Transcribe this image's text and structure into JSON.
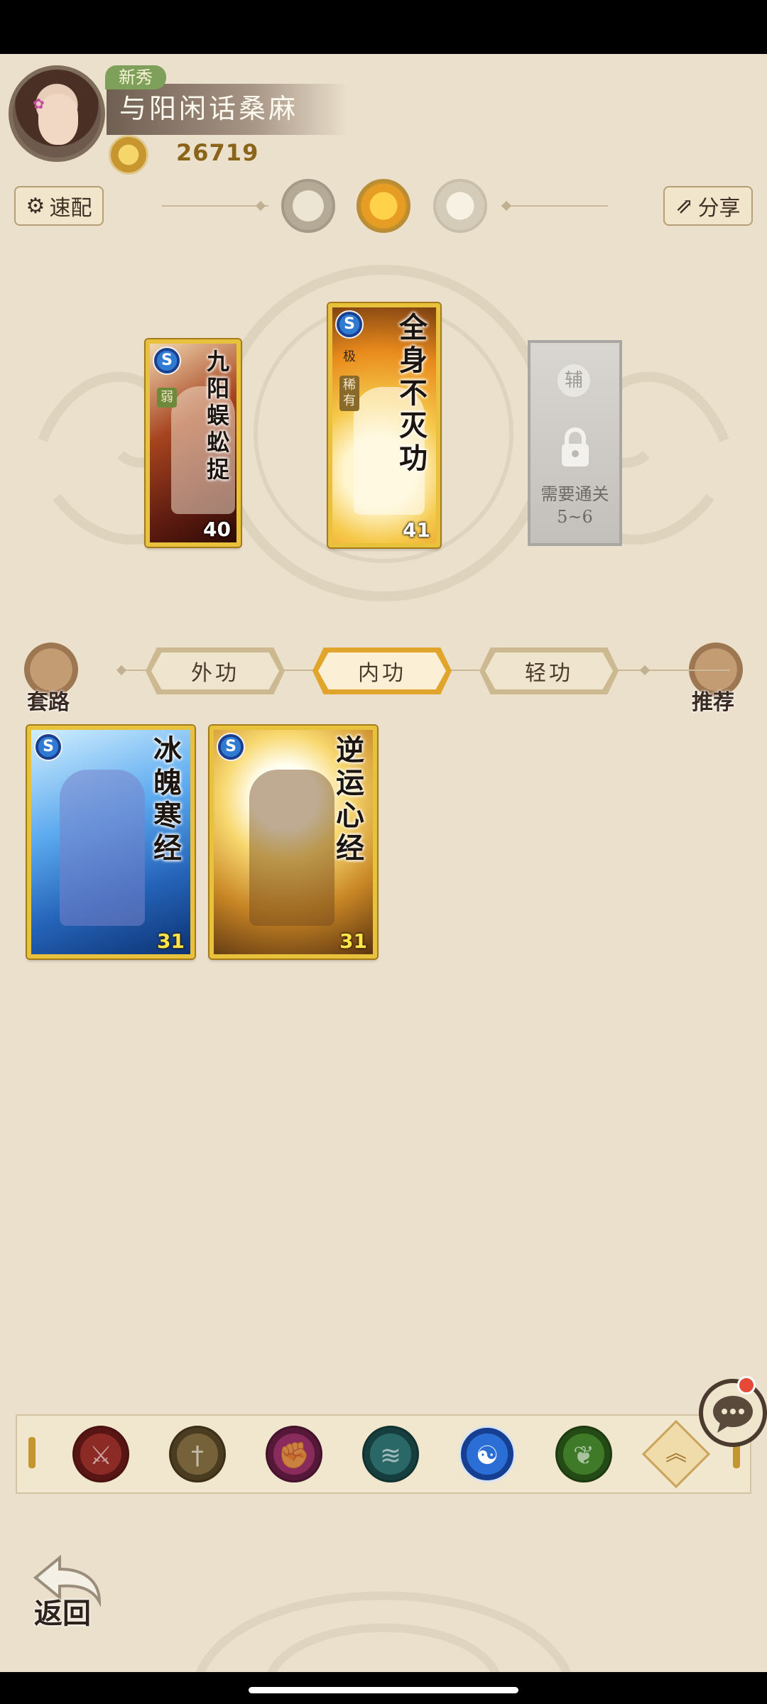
{
  "player": {
    "rank": "新秀",
    "name": "与阳闲话桑麻",
    "power": "26719"
  },
  "toolbar": {
    "speed_label": "速配",
    "share_label": "分享"
  },
  "equipped": {
    "slots": [
      {
        "title": "九阳蜈蚣捉",
        "tag": "弱",
        "level": "40"
      },
      {
        "title": "全身不灭功",
        "tag_top": "极",
        "tag": "稀有",
        "level": "41"
      }
    ],
    "locked": {
      "assist": "辅",
      "requirement": "需要通关",
      "stage": "5~6"
    }
  },
  "tabs": {
    "left_button": "套路",
    "right_button": "推荐",
    "items": [
      "外功",
      "内功",
      "轻功"
    ],
    "active": "内功"
  },
  "skills": [
    {
      "title": "冰魄寒经",
      "level": "31"
    },
    {
      "title": "逆运心经",
      "level": "31"
    }
  ],
  "schools": [
    {
      "name": "blade-school-icon",
      "color": "#6a1f1c"
    },
    {
      "name": "sword-school-icon",
      "color": "#5a4a2c"
    },
    {
      "name": "fist-school-icon",
      "color": "#6b2147"
    },
    {
      "name": "fan-school-icon",
      "color": "#1f4f4f"
    },
    {
      "name": "taiji-school-icon",
      "color": "#1a4fb5"
    },
    {
      "name": "leaf-school-icon",
      "color": "#2f5a1f"
    }
  ],
  "nav": {
    "back_label": "返回"
  },
  "colors": {
    "background": "#ebe0cc",
    "card_border": "#e8c23c",
    "active_tab": "#e0a52a"
  }
}
